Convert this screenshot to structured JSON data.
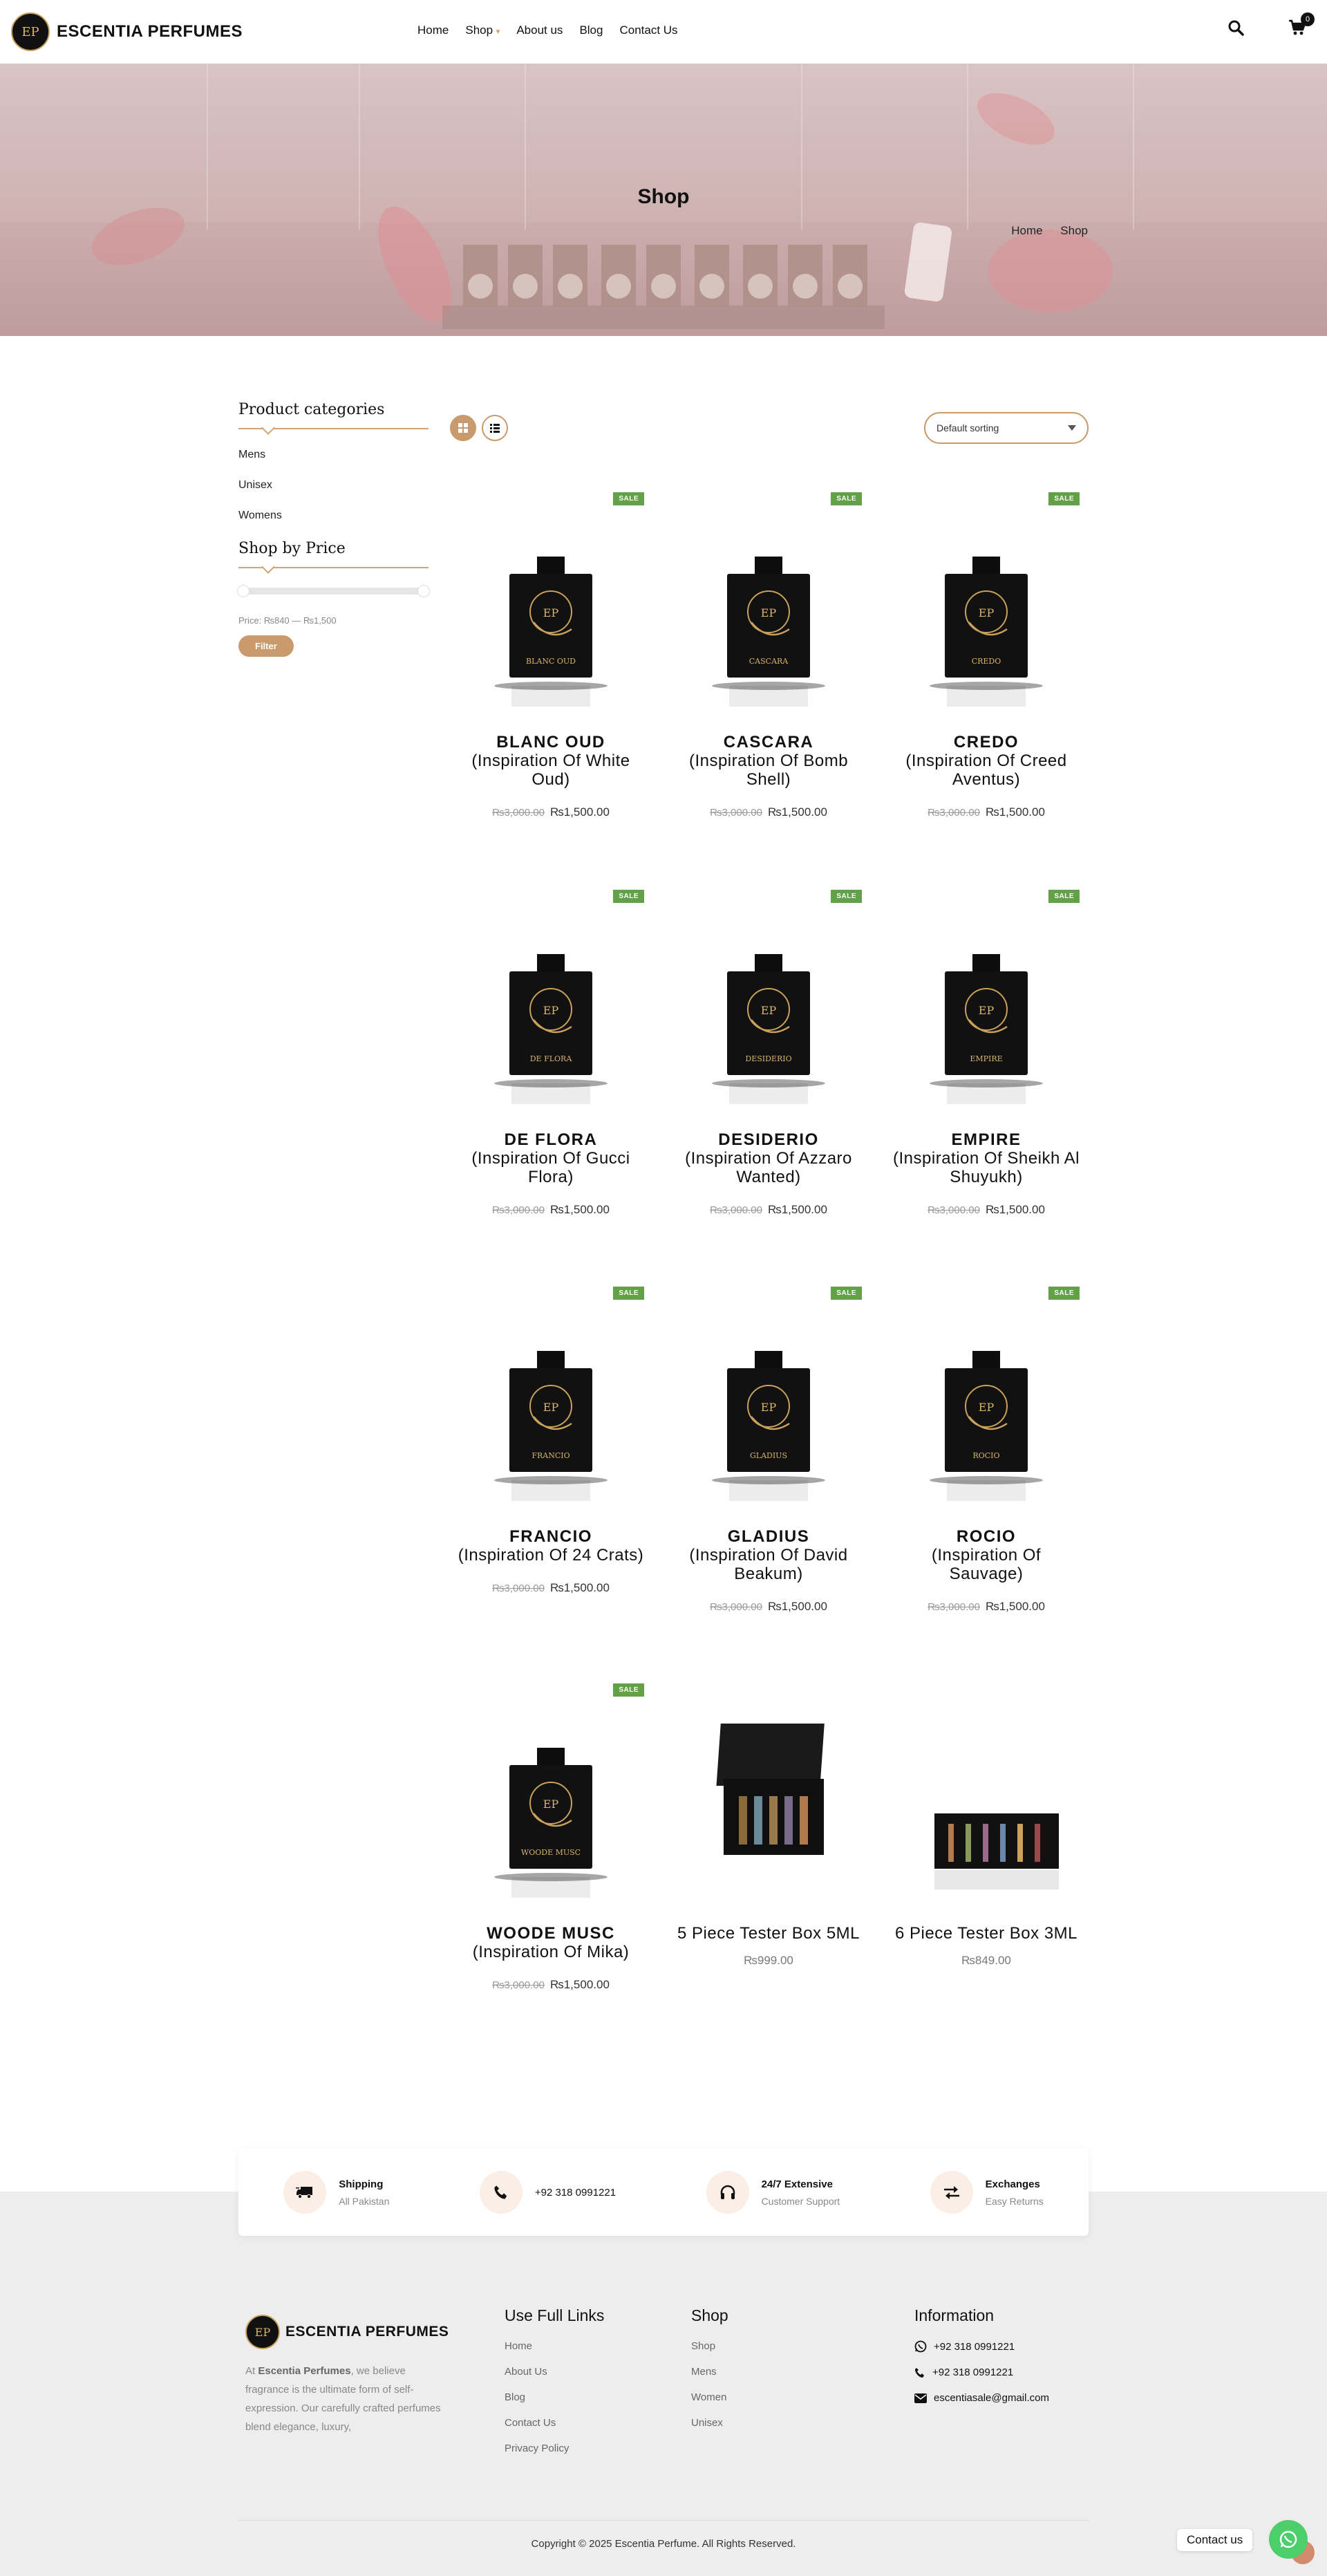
{
  "brand": {
    "name": "ESCENTIA PERFUMES",
    "logo_mark": "EP"
  },
  "nav": {
    "items": [
      "Home",
      "Shop",
      "About us",
      "Blog",
      "Contact Us"
    ],
    "active": "Shop",
    "dropdown_caret": "▾"
  },
  "header_icons": {
    "search": "search-icon",
    "cart": "cart-icon",
    "cart_count": "0"
  },
  "hero": {
    "title": "Shop",
    "breadcrumb": [
      "Home",
      "Shop"
    ],
    "separator": "·"
  },
  "sidebar": {
    "categories_title": "Product categories",
    "categories": [
      "Mens",
      "Unisex",
      "Womens"
    ],
    "price_title": "Shop by Price",
    "price_range_text": "Price: ₨840 — ₨1,500",
    "filter_label": "Filter"
  },
  "toolbar": {
    "sort_value": "Default sorting",
    "views": [
      "grid-view",
      "list-view"
    ],
    "active_view": "grid-view"
  },
  "sale_label": "SALE",
  "products": [
    {
      "name": "BLANC OUD",
      "subtitle": "(Inspiration Of White Oud)",
      "old_price": "₨3,000.00",
      "price": "₨1,500.00",
      "sale": true,
      "image": "bottle",
      "label": "BLANC OUD"
    },
    {
      "name": "CASCARA",
      "subtitle": "(Inspiration Of Bomb Shell)",
      "old_price": "₨3,000.00",
      "price": "₨1,500.00",
      "sale": true,
      "image": "bottle",
      "label": "CASCARA"
    },
    {
      "name": "CREDO",
      "subtitle": "(Inspiration Of Creed Aventus)",
      "old_price": "₨3,000.00",
      "price": "₨1,500.00",
      "sale": true,
      "image": "bottle",
      "label": "CREDO"
    },
    {
      "name": "DE FLORA",
      "subtitle": "(Inspiration Of Gucci Flora)",
      "old_price": "₨3,000.00",
      "price": "₨1,500.00",
      "sale": true,
      "image": "bottle",
      "label": "DE FLORA"
    },
    {
      "name": "DESIDERIO",
      "subtitle": "(Inspiration Of Azzaro Wanted)",
      "old_price": "₨3,000.00",
      "price": "₨1,500.00",
      "sale": true,
      "image": "bottle",
      "label": "DESIDERIO"
    },
    {
      "name": "EMPIRE",
      "subtitle": "(Inspiration Of Sheikh Al Shuyukh)",
      "old_price": "₨3,000.00",
      "price": "₨1,500.00",
      "sale": true,
      "image": "bottle",
      "label": "EMPIRE"
    },
    {
      "name": "FRANCIO",
      "subtitle": "(Inspiration Of 24 Crats)",
      "old_price": "₨3,000.00",
      "price": "₨1,500.00",
      "sale": true,
      "image": "bottle",
      "label": "FRANCIO"
    },
    {
      "name": "GLADIUS",
      "subtitle": "(Inspiration Of David Beakum)",
      "old_price": "₨3,000.00",
      "price": "₨1,500.00",
      "sale": true,
      "image": "bottle",
      "label": "GLADIUS"
    },
    {
      "name": "ROCIO",
      "subtitle": "(Inspiration Of Sauvage)",
      "old_price": "₨3,000.00",
      "price": "₨1,500.00",
      "sale": true,
      "image": "bottle",
      "label": "ROCIO"
    },
    {
      "name": "WOODE MUSC",
      "subtitle": "(Inspiration Of Mika)",
      "old_price": "₨3,000.00",
      "price": "₨1,500.00",
      "sale": true,
      "image": "bottle",
      "label": "WOODE MUSC"
    },
    {
      "name": "",
      "subtitle": "5 Piece Tester Box 5ML",
      "old_price": "",
      "price": "₨999.00",
      "sale": false,
      "image": "box-open",
      "label": ""
    },
    {
      "name": "",
      "subtitle": "6 Piece Tester Box 3ML",
      "old_price": "",
      "price": "₨849.00",
      "sale": false,
      "image": "box-flat",
      "label": ""
    }
  ],
  "features": [
    {
      "title": "Shipping",
      "sub": "All Pakistan",
      "icon": "truck-icon"
    },
    {
      "title": "+92 318 0991221",
      "sub": "",
      "icon": "phone-icon"
    },
    {
      "title": "24/7 Extensive",
      "sub": "Customer Support",
      "icon": "headphones-icon"
    },
    {
      "title": "Exchanges",
      "sub": "Easy Returns",
      "icon": "exchange-icon"
    }
  ],
  "footer": {
    "about_prefix": "At ",
    "about_brand": "Escentia Perfumes",
    "about_rest": ", we believe fragrance is the ultimate form of self-expression. Our carefully crafted perfumes blend elegance, luxury,",
    "links_title": "Use Full Links",
    "links": [
      "Home",
      "About Us",
      "Blog",
      "Contact Us",
      "Privacy Policy"
    ],
    "shop_title": "Shop",
    "shop_links": [
      "Shop",
      "Mens",
      "Women",
      "Unisex"
    ],
    "info_title": "Information",
    "whatsapp": "+92 318 0991221",
    "phone": "+92 318 0991221",
    "email": "escentiasale@gmail.com",
    "copyright": "Copyright © 2025 Escentia Perfume. All Rights Reserved."
  },
  "whatsapp_widget": {
    "label": "Contact us"
  },
  "colors": {
    "accent": "#c99a6b",
    "sale": "#62a148",
    "hero": "#d3bbbb",
    "footer_bg": "#ededed"
  }
}
